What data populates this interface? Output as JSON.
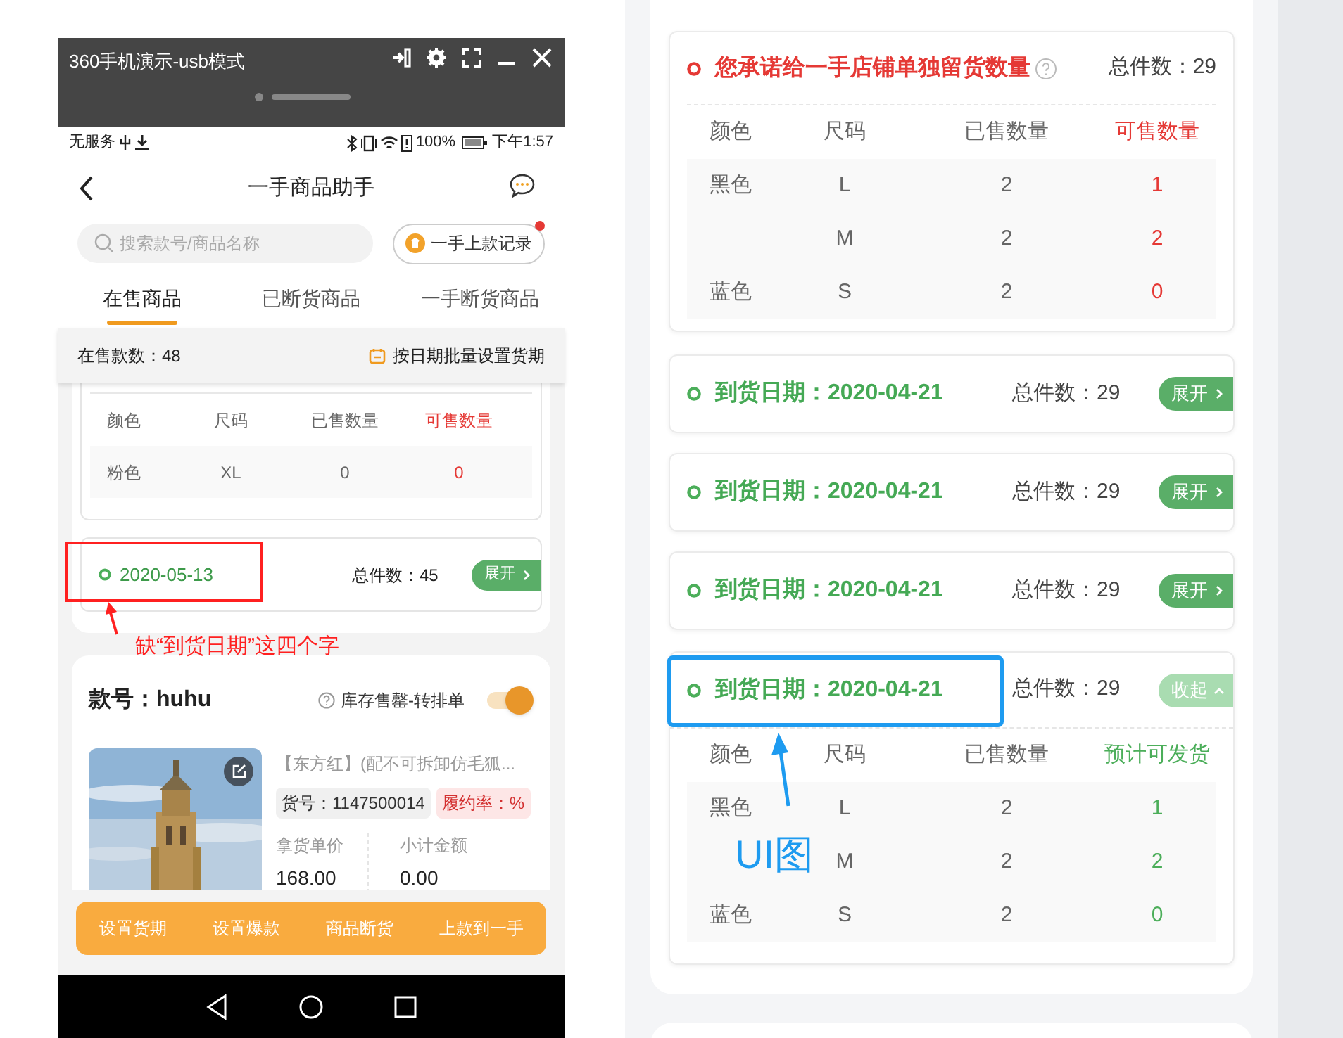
{
  "emulator": {
    "title": "360手机演示-usb模式"
  },
  "status_bar": {
    "carrier": "无服务",
    "battery": "100%",
    "time": "下午1:57"
  },
  "header": {
    "title": "一手商品助手"
  },
  "search": {
    "placeholder": "搜索款号/商品名称"
  },
  "record_button": {
    "label": "一手上款记录",
    "has_new": true
  },
  "tabs": [
    {
      "label": "在售商品",
      "selected": true
    },
    {
      "label": "已断货商品",
      "selected": false
    },
    {
      "label": "一手断货商品",
      "selected": false
    }
  ],
  "summary": {
    "count": "在售款数：48",
    "batch_link": "按日期批量设置货期"
  },
  "stock_table": {
    "kind": "available",
    "columns": [
      "颜色",
      "尺码",
      "已售数量",
      "可售数量"
    ],
    "rows": [
      {
        "color_name": "粉色",
        "size": "XL",
        "sold": "0",
        "available": "0"
      }
    ]
  },
  "arrival": {
    "date": "2020-05-13",
    "total": "总件数：45",
    "button": "展开",
    "expanded": false
  },
  "annotation_missing": "缺“到货日期”这四个字",
  "product": {
    "style": "款号：huhu",
    "toggle_label": "库存售罄-转排单",
    "toggle_on": true,
    "name": "【东方红】(配不可拆卸仿毛狐...",
    "sku": "货号：1147500014",
    "rate": "履约率：%",
    "price_label": "拿货单价",
    "price": "168.00",
    "subtotal_label": "小计金额",
    "subtotal": "0.00"
  },
  "actions": [
    "设置货期",
    "设置爆款",
    "商品断货",
    "上款到一手"
  ],
  "reserve_card": {
    "title": "您承诺给一手店铺单独留货数量",
    "total": "总件数：29",
    "table": {
      "kind": "available",
      "columns": [
        "颜色",
        "尺码",
        "已售数量",
        "可售数量"
      ],
      "rows": [
        {
          "color_name": "黑色",
          "size": "L",
          "sold": "2",
          "available": "1"
        },
        {
          "size": "M",
          "sold": "2",
          "available": "2"
        },
        {
          "color_name": "蓝色",
          "size": "S",
          "sold": "2",
          "available": "0"
        }
      ]
    }
  },
  "arrival_cards": [
    {
      "label": "到货日期：2020-04-21",
      "total": "总件数：29",
      "button": "展开",
      "expanded": false
    },
    {
      "label": "到货日期：2020-04-21",
      "total": "总件数：29",
      "button": "展开",
      "expanded": false
    },
    {
      "label": "到货日期：2020-04-21",
      "total": "总件数：29",
      "button": "展开",
      "expanded": false
    },
    {
      "label": "到货日期：2020-04-21",
      "total": "总件数：29",
      "button": "收起",
      "expanded": true,
      "table": {
        "kind": "forecast",
        "columns": [
          "颜色",
          "尺码",
          "已售数量",
          "预计可发货"
        ],
        "rows": [
          {
            "color_name": "黑色",
            "size": "L",
            "sold": "2",
            "available": "1"
          },
          {
            "size": "M",
            "sold": "2",
            "available": "2"
          },
          {
            "color_name": "蓝色",
            "size": "S",
            "sold": "2",
            "available": "0"
          }
        ]
      }
    }
  ],
  "annotation_ui": "UI图"
}
